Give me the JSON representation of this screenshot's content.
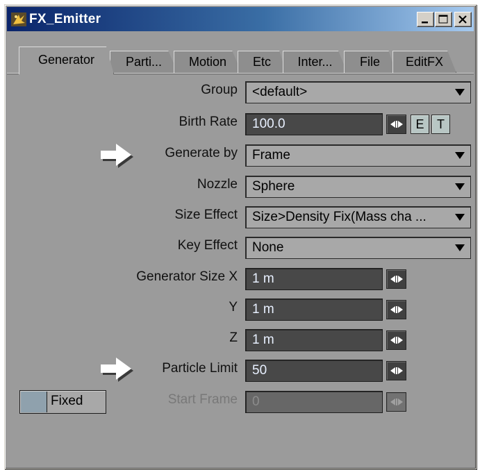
{
  "window": {
    "title": "FX_Emitter",
    "controls": {
      "minimize": "minimize-icon",
      "maximize": "maximize-icon",
      "close": "close-icon"
    }
  },
  "tabs": [
    {
      "label": "Generator",
      "active": true
    },
    {
      "label": "Parti..."
    },
    {
      "label": "Motion"
    },
    {
      "label": "Etc"
    },
    {
      "label": "Inter..."
    },
    {
      "label": "File"
    },
    {
      "label": "EditFX"
    }
  ],
  "fields": {
    "group": {
      "label": "Group",
      "value": "<default>"
    },
    "birth_rate": {
      "label": "Birth Rate",
      "value": "100.0",
      "env_button": "E",
      "texture_button": "T"
    },
    "generate_by": {
      "label": "Generate by",
      "value": "Frame"
    },
    "nozzle": {
      "label": "Nozzle",
      "value": "Sphere"
    },
    "size_effect": {
      "label": "Size Effect",
      "value": "Size>Density Fix(Mass cha ..."
    },
    "key_effect": {
      "label": "Key Effect",
      "value": "None"
    },
    "generator_size_x": {
      "label": "Generator Size X",
      "value": "1 m"
    },
    "generator_size_y": {
      "label": "Y",
      "value": "1 m"
    },
    "generator_size_z": {
      "label": "Z",
      "value": "1 m"
    },
    "particle_limit": {
      "label": "Particle Limit",
      "value": "50"
    },
    "start_frame": {
      "label": "Start Frame",
      "value": "0",
      "disabled": true
    }
  },
  "fixed_button": {
    "label": "Fixed"
  },
  "colors": {
    "panel": "#9b9b9b",
    "title_gradient_start": "#0a246a",
    "title_gradient_end": "#a6caf0",
    "numeric_field": "#484848",
    "select_field": "#a8a8a8"
  }
}
